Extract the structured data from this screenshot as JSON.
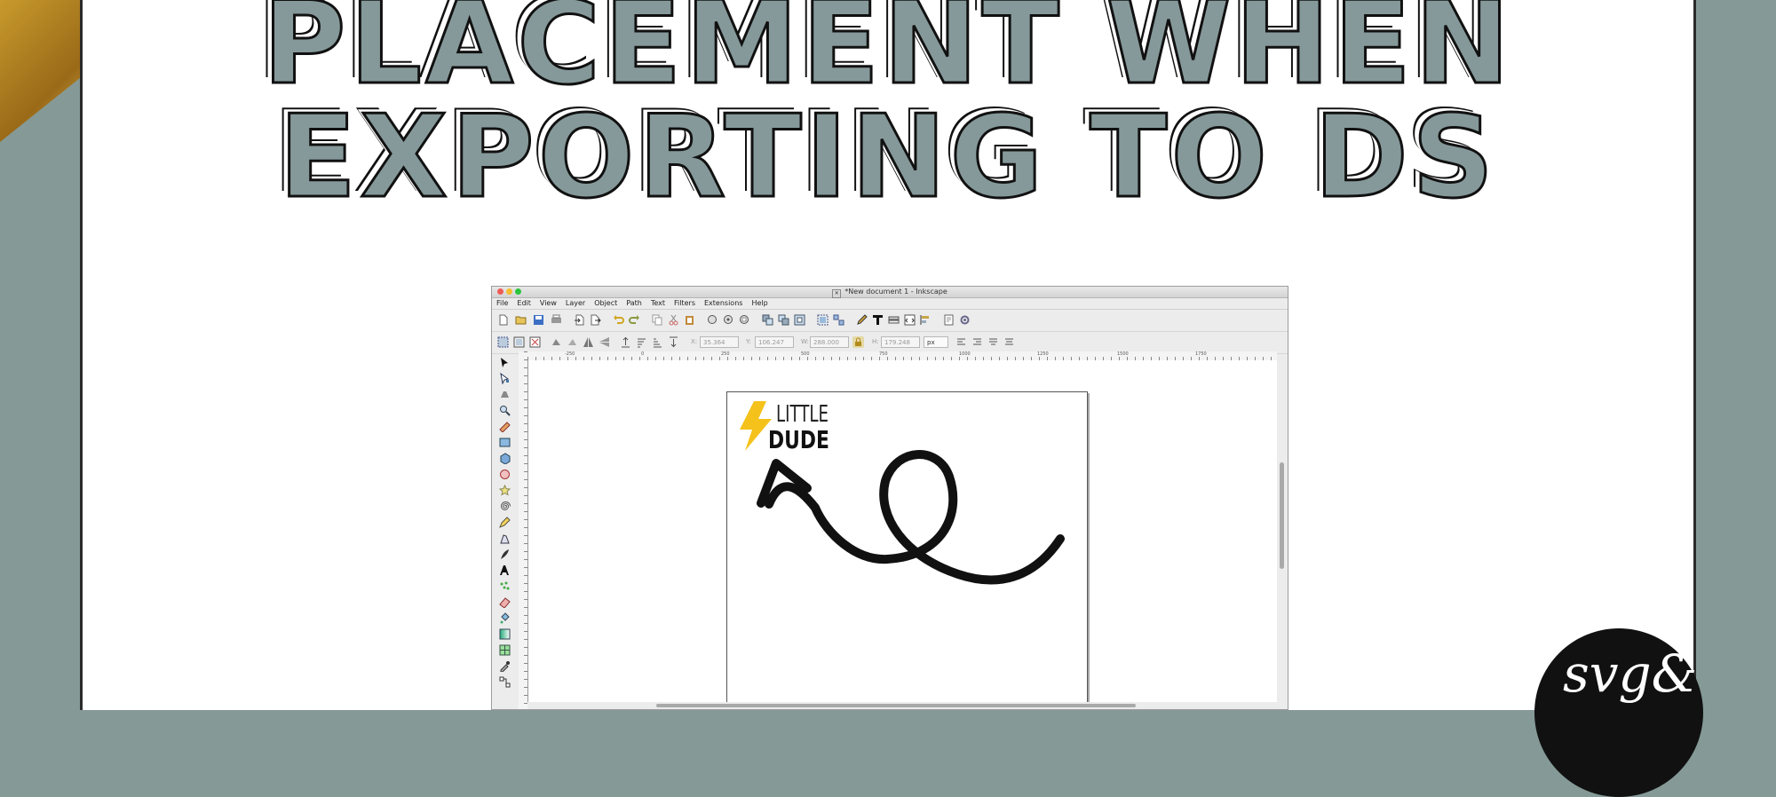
{
  "headline": {
    "line1": "PLACEMENT WHEN",
    "line2": "EXPORTING TO DS"
  },
  "window": {
    "title": "*New document 1 - Inkscape",
    "menu": [
      "File",
      "Edit",
      "View",
      "Layer",
      "Object",
      "Path",
      "Text",
      "Filters",
      "Extensions",
      "Help"
    ],
    "fields": {
      "x_label": "X:",
      "x_value": "35.364",
      "y_label": "Y:",
      "y_value": "106.247",
      "w_label": "W:",
      "w_value": "288.000",
      "h_label": "H:",
      "h_value": "179.248",
      "unit": "px"
    },
    "ruler_labels": [
      "-250",
      "0",
      "250",
      "500",
      "750",
      "1000",
      "1250",
      "1500",
      "1750"
    ]
  },
  "design": {
    "logo_line1": "LITTLE",
    "logo_line2": "DUDE",
    "bolt_color": "#f4c21b"
  },
  "badge": {
    "text": "svg&"
  },
  "colors": {
    "sage": "#859a97",
    "gold": "#c89a2c"
  }
}
